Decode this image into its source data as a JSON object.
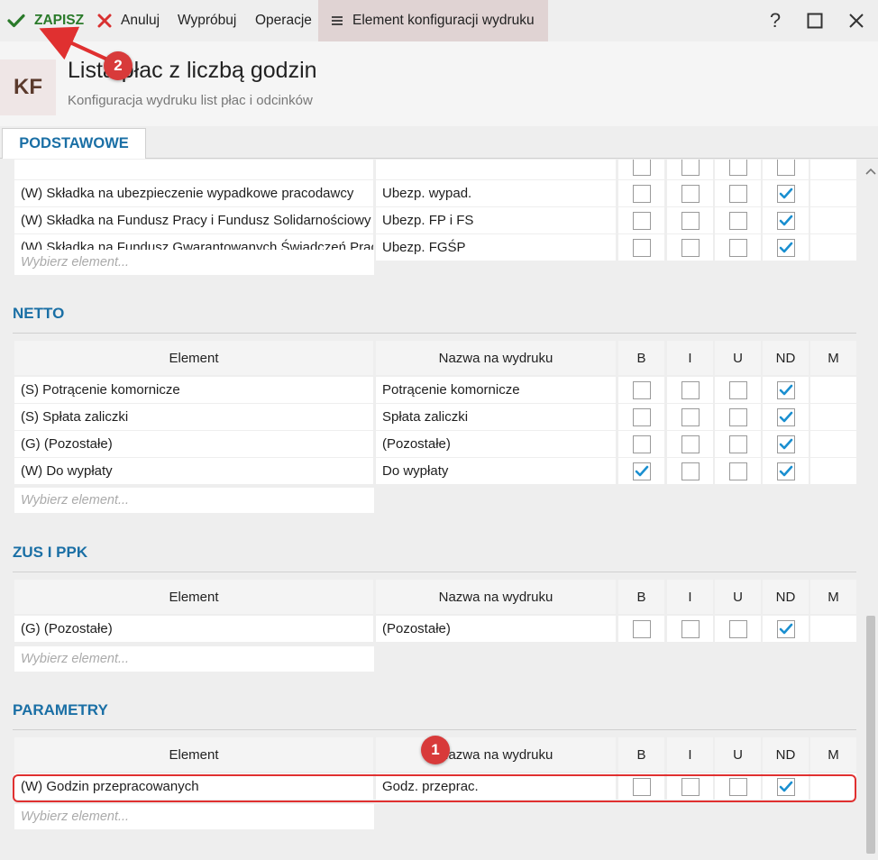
{
  "toolbar": {
    "save_label": "ZAPISZ",
    "cancel_label": "Anuluj",
    "try_label": "Wypróbuj",
    "operations_label": "Operacje",
    "element_config_label": "Element konfiguracji wydruku",
    "help_label": "?"
  },
  "header": {
    "badge": "KF",
    "title": "Lista płac z liczbą godzin",
    "subtitle": "Konfiguracja wydruku list płac i odcinków"
  },
  "tab": {
    "label": "PODSTAWOWE"
  },
  "columns": {
    "element": "Element",
    "print_name": "Nazwa na wydruku",
    "b": "B",
    "i": "I",
    "u": "U",
    "nd": "ND",
    "m": "M"
  },
  "placeholder": "Wybierz element...",
  "podstawowe": {
    "rows": [
      {
        "element": "(W) Składka na ubezpieczenie wypadkowe pracodawcy",
        "print_name": "Ubezp. wypad.",
        "b": false,
        "i": false,
        "u": false,
        "nd": true
      },
      {
        "element": "(W) Składka na Fundusz Pracy i Fundusz Solidarnościowy",
        "print_name": "Ubezp. FP i FS",
        "b": false,
        "i": false,
        "u": false,
        "nd": true
      },
      {
        "element": "(W) Składka na Fundusz Gwarantowanych Świadczeń Pracowniczych",
        "print_name": "Ubezp. FGŚP",
        "b": false,
        "i": false,
        "u": false,
        "nd": true
      }
    ]
  },
  "netto": {
    "title": "NETTO",
    "rows": [
      {
        "element": "(S) Potrącenie komornicze",
        "print_name": "Potrącenie komornicze",
        "b": false,
        "i": false,
        "u": false,
        "nd": true
      },
      {
        "element": "(S) Spłata zaliczki",
        "print_name": "Spłata zaliczki",
        "b": false,
        "i": false,
        "u": false,
        "nd": true
      },
      {
        "element": "(G) (Pozostałe)",
        "print_name": "(Pozostałe)",
        "b": false,
        "i": false,
        "u": false,
        "nd": true
      },
      {
        "element": "(W) Do wypłaty",
        "print_name": "Do wypłaty",
        "b": true,
        "i": false,
        "u": false,
        "nd": true
      }
    ]
  },
  "zus": {
    "title": "ZUS I PPK",
    "rows": [
      {
        "element": "(G) (Pozostałe)",
        "print_name": "(Pozostałe)",
        "b": false,
        "i": false,
        "u": false,
        "nd": true
      }
    ]
  },
  "parametry": {
    "title": "PARAMETRY",
    "rows": [
      {
        "element": "(W) Godzin przepracowanych",
        "print_name": "Godz. przeprac.",
        "b": false,
        "i": false,
        "u": false,
        "nd": true
      }
    ]
  },
  "annotations": {
    "badge_1": "1",
    "badge_2": "2"
  },
  "colors": {
    "accent_blue": "#1a6fa5",
    "save_green": "#2a7a2a",
    "annotation_red": "#d83a3a",
    "checkbox_blue": "#1a8fd0"
  }
}
